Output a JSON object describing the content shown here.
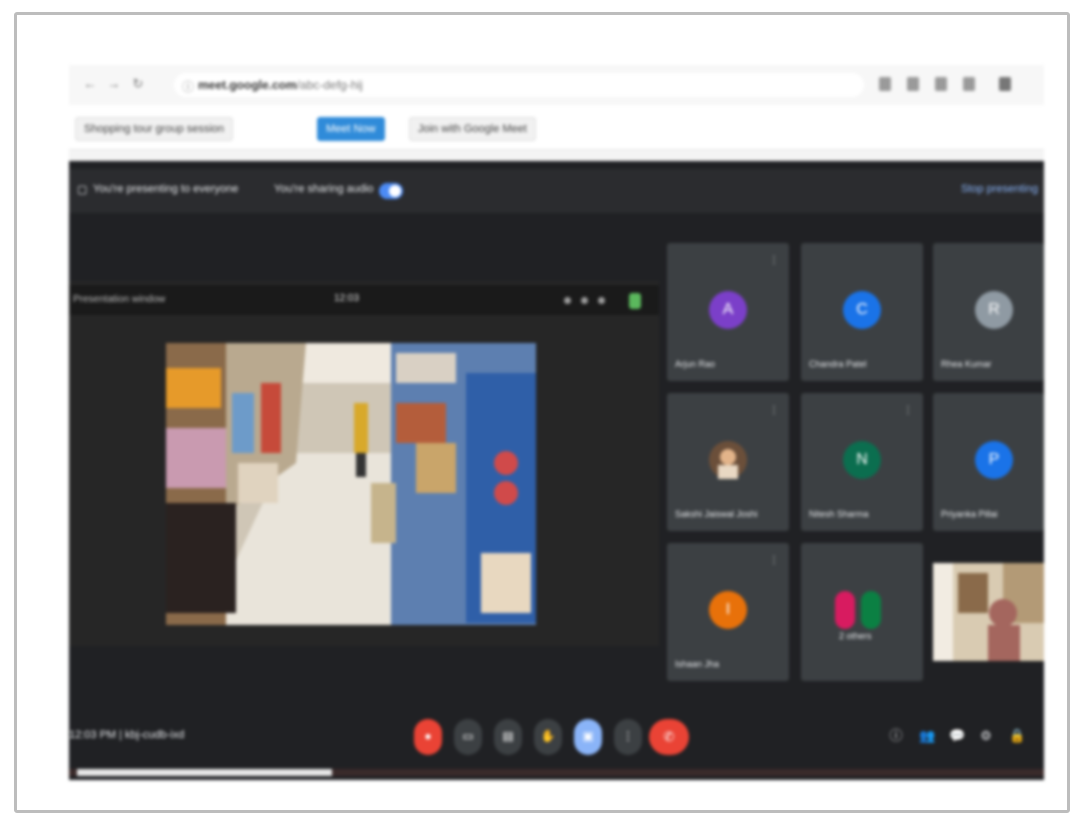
{
  "browser": {
    "url_host": "meet.google.com",
    "url_path": "/abc-defg-hij",
    "bookmarks": [
      {
        "label": "Shopping tour group session",
        "active": false
      },
      {
        "label": "Meet Now",
        "active": true
      },
      {
        "label": "Join with Google Meet",
        "active": false
      }
    ]
  },
  "meet": {
    "top_bar": {
      "recording_label": "You're presenting to everyone",
      "audio_label": "You're sharing audio",
      "right_link": "Stop presenting"
    },
    "share": {
      "header_text": "Presentation window",
      "time": "12:03"
    },
    "participants": [
      {
        "name": "Arjun Rao",
        "initial": "A",
        "color": "#7b3fc9",
        "avatar_type": "initial"
      },
      {
        "name": "Chandra Patel",
        "initial": "C",
        "color": "#1a73e8",
        "avatar_type": "initial"
      },
      {
        "name": "Rhea Kumar",
        "initial": "R",
        "color": "#8f9aa3",
        "avatar_type": "initial"
      },
      {
        "name": "Sakshi Jaiswal Joshi",
        "initial": "",
        "color": "#5f4a3a",
        "avatar_type": "photo"
      },
      {
        "name": "Nitesh Sharma",
        "initial": "N",
        "color": "#0b6e4f",
        "avatar_type": "initial"
      },
      {
        "name": "Priyanka Pillai",
        "initial": "P",
        "color": "#1a73e8",
        "avatar_type": "initial"
      },
      {
        "name": "Ishaan Jha",
        "initial": "I",
        "color": "#e8710a",
        "avatar_type": "initial"
      },
      {
        "name": "2 others",
        "initial": "",
        "color": "#3c4043",
        "avatar_type": "group"
      },
      {
        "name": "",
        "initial": "",
        "color": "#6a5a4a",
        "avatar_type": "video"
      }
    ],
    "bottom": {
      "meeting_info": "12:03 PM  |  kbj-cudb-ixd"
    }
  },
  "icons": {
    "back": "arrow-left-icon",
    "reload": "reload-icon",
    "info": "info-icon",
    "mic": "microphone-icon",
    "camera": "camera-icon",
    "captions": "captions-icon",
    "hand": "raise-hand-icon",
    "present": "present-icon",
    "more": "more-vert-icon",
    "end": "end-call-icon"
  },
  "colors": {
    "meet_bg": "#202124",
    "tile_bg": "#3c4043",
    "accent_blue": "#8ab4f8",
    "end_red": "#ea4335"
  }
}
